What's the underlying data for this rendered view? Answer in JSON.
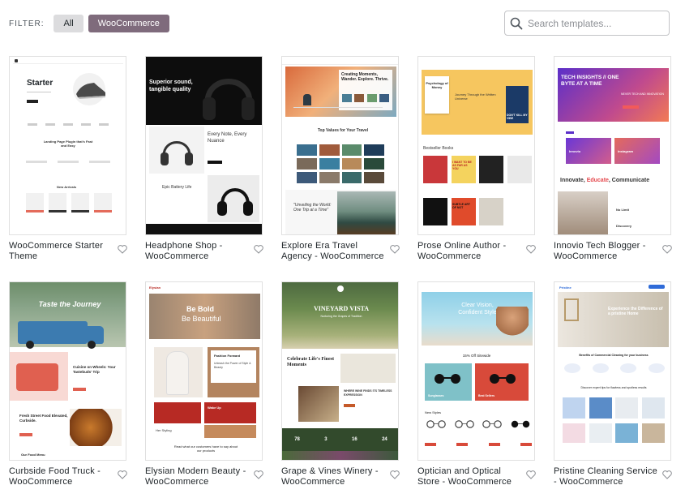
{
  "filter": {
    "label": "FILTER:",
    "options": [
      "All",
      "WooCommerce"
    ],
    "selected": "WooCommerce"
  },
  "search": {
    "placeholder": "Search templates..."
  },
  "templates": [
    {
      "caption": "WooCommerce Starter Theme",
      "thumb": {
        "headline": "Starter",
        "section1": "Landing Page Plugin that's Fast and Easy",
        "section2": "New Arrivals"
      }
    },
    {
      "caption": "Headphone Shop - WooCommerce",
      "thumb": {
        "headline": "Superior sound, tangible quality",
        "section1": "Every Note, Every Nuance",
        "section2": "Epic Battery Life"
      }
    },
    {
      "caption": "Explore Era Travel Agency - WooCommerce",
      "thumb": {
        "headline": "Creating Moments, Wander. Explore. Thrive.",
        "section1": "Top Values for Your Travel",
        "section2": "\"Unveiling the World: One Trip at a Time\""
      }
    },
    {
      "caption": "Prose Online Author - WooCommerce",
      "thumb": {
        "headline": "Journey Through the Written Universe",
        "book": "Psychology of Money",
        "book2": "DON'T KILL MY VIBE",
        "section1": "Bestseller Books",
        "book3": "I WANT TO BE AS FAR AS YOU",
        "book4": "SUBTLE ART OF NOT"
      }
    },
    {
      "caption": "Innovio Tech Blogger - WooCommerce",
      "thumb": {
        "headline": "TECH INSIGHTS // ONE BYTE AT A TIME",
        "cta": "NEVER TECH AND INNOVATION",
        "card1": "Innovio",
        "card2": "Instagram",
        "tagline_a": "Innovate, ",
        "tagline_b": "Educate",
        "tagline_c": ", Communicate",
        "label1": "No Limit",
        "label2": "Discovery"
      }
    },
    {
      "caption": "Curbside Food Truck - WooCommerce",
      "thumb": {
        "headline": "Taste the Journey",
        "section1": "Cuisine on Wheels: Your Tastebuds' Trip",
        "section2": "Fresh Street Food Elevated, Curbside.",
        "section3": "Our Food Menu"
      }
    },
    {
      "caption": "Elysian Modern Beauty - WooCommerce",
      "thumb": {
        "brand": "Elysian",
        "headline_a": "Be Bold",
        "headline_b": "Be Beautiful",
        "section1": "Fashion Forward",
        "section2": "Unleash the Power of Style & Beauty",
        "label1": "Wake Up",
        "label2": "Her Styling",
        "footer": "Read what our customers have to say about our products"
      }
    },
    {
      "caption": "Grape & Vines Winery - WooCommerce",
      "thumb": {
        "headline": "VINEYARD VISTA",
        "sub": "Nurturing the Grapes of Tradition",
        "section1": "Celebrate Life's Finest Moments",
        "section2": "WHERE WINE FINDS ITS TIMELESS EXPRESSION",
        "stats": [
          "78",
          "3",
          "16",
          "24"
        ]
      }
    },
    {
      "caption": "Optician and Optical Store - WooCommerce",
      "thumb": {
        "headline": "Clear Vision, Confident Style",
        "section1": "15% Off Sitewide",
        "label1": "Sunglasses",
        "label2": "Best Sellers",
        "section2": "New Styles"
      }
    },
    {
      "caption": "Pristine Cleaning Service - WooCommerce",
      "thumb": {
        "brand": "Pristine",
        "headline": "Experience the Difference of a pristine Home",
        "section1": "Benefits of Commercial Cleaning for your business",
        "section2": "Discover expert tips for flawless and spotless results"
      }
    }
  ],
  "colors": {
    "accent": "#7f6b7c",
    "chip_inactive": "#dcdcde",
    "travel_nav": "#1b4f66",
    "prose_yellow": "#f6c65f",
    "innovio_grad_start": "#5b2fc9",
    "innovio_grad_end": "#f27a54",
    "innovio_red": "#e5484d",
    "truck_blue": "#3c7bb0",
    "beauty_tan": "#c8a17f",
    "beauty_red": "#b72a24",
    "winery_green": "#324a2c",
    "optic_sky": "#8fd0e8",
    "optic_red": "#d84a3a",
    "clean_blue": "#2f6bd8"
  }
}
